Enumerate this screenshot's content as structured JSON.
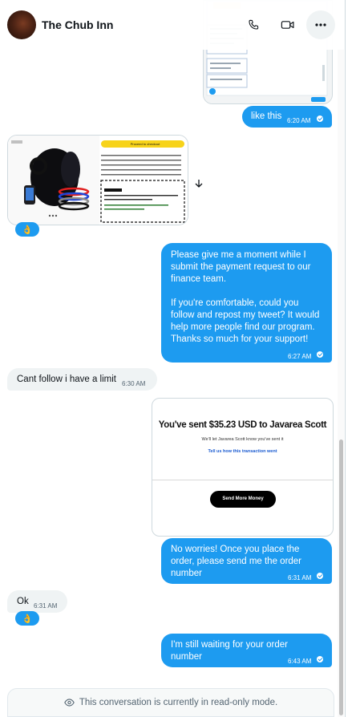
{
  "header": {
    "contact_name": "The Chub Inn",
    "icons": [
      "phone-icon",
      "video-icon",
      "more-icon"
    ]
  },
  "messages": {
    "m1_text": "like this",
    "m1_time": "6:20 AM",
    "m3_text": "Please give me a moment while I submit the payment request to our finance team.\n\nIf you're comfortable, could you follow and repost my tweet? It would help more people find our program. Thanks so much for your support!",
    "m3_time": "6:27 AM",
    "m4_text": "Cant follow i have a limit",
    "m4_time": "6:30 AM",
    "m6_text": "No worries! Once you place the order, please send me the order number",
    "m6_time": "6:31 AM",
    "m7_text": "Ok",
    "m7_time": "6:31 AM",
    "m8_text": "I'm still waiting for your order number",
    "m8_time": "6:43 AM"
  },
  "reaction": "👌",
  "payment_card": {
    "title": "You've sent $35.23 USD to Javarea Scott",
    "subtitle": "We'll let Javarea Scott know you've sent it",
    "link": "Tell us how this transaction went",
    "button": "Send More Money"
  },
  "product_shot": {
    "cta": "Proceed to checkout"
  },
  "footer": {
    "readonly_text": "This conversation is currently in read-only mode."
  },
  "colors": {
    "accent": "#1d9bf0",
    "incoming_bg": "#eff3f4",
    "text_primary": "#0f1419",
    "text_secondary": "#536471"
  }
}
